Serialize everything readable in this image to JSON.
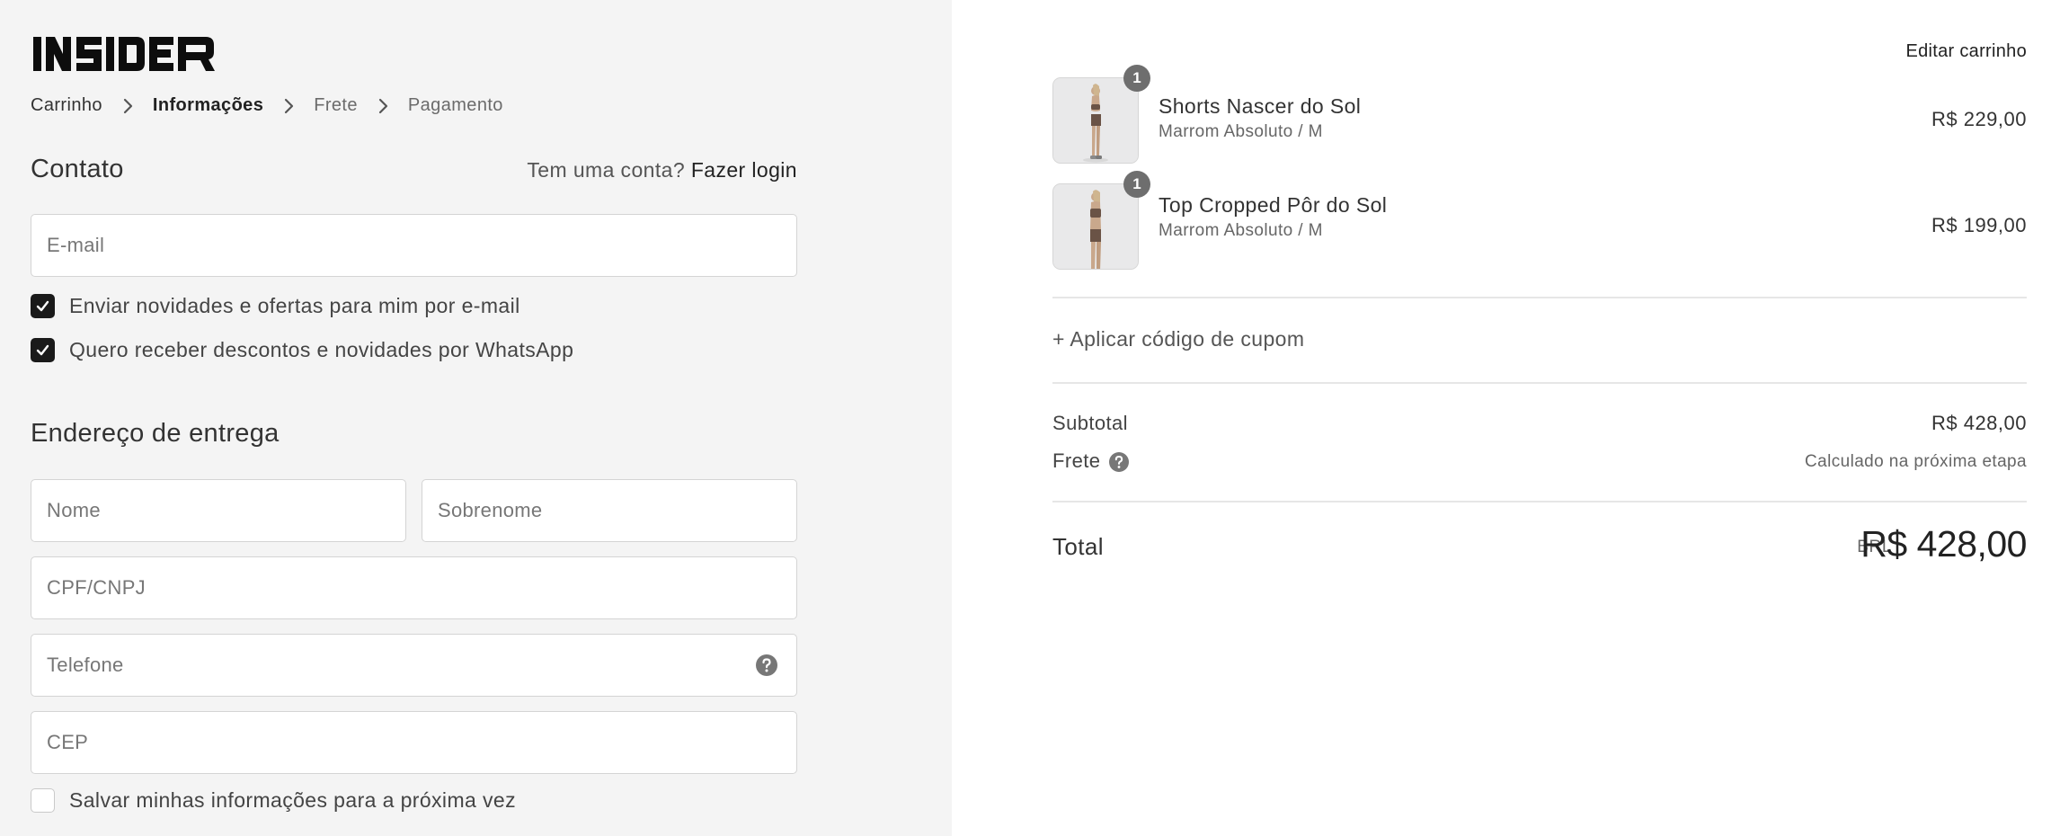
{
  "brand": {
    "logo_text": "INSIDER"
  },
  "breadcrumb": {
    "items": [
      {
        "label": "Carrinho",
        "state": "link"
      },
      {
        "label": "Informações",
        "state": "current"
      },
      {
        "label": "Frete",
        "state": "upcoming"
      },
      {
        "label": "Pagamento",
        "state": "upcoming"
      }
    ]
  },
  "contact": {
    "title": "Contato",
    "login_prompt": "Tem uma conta?",
    "login_link": "Fazer login",
    "email_placeholder": "E-mail",
    "options": [
      {
        "label": "Enviar novidades e ofertas para mim por e-mail",
        "checked": true
      },
      {
        "label": "Quero receber descontos e novidades por WhatsApp",
        "checked": true
      }
    ]
  },
  "shipping_address": {
    "title": "Endereço de entrega",
    "first_name_placeholder": "Nome",
    "last_name_placeholder": "Sobrenome",
    "document_placeholder": "CPF/CNPJ",
    "phone_placeholder": "Telefone",
    "zip_placeholder": "CEP",
    "save_info_label": "Salvar minhas informações para a próxima vez",
    "save_info_checked": false
  },
  "cart": {
    "edit_label": "Editar carrinho",
    "items": [
      {
        "name": "Shorts Nascer do Sol",
        "variant": "Marrom Absoluto / M",
        "price": "R$ 229,00",
        "quantity": "1"
      },
      {
        "name": "Top Cropped Pôr do Sol",
        "variant": "Marrom Absoluto / M",
        "price": "R$ 199,00",
        "quantity": "1"
      }
    ],
    "coupon_label": "+ Aplicar código de cupom"
  },
  "summary": {
    "subtotal_label": "Subtotal",
    "subtotal_value": "R$ 428,00",
    "shipping_label": "Frete",
    "shipping_value": "Calculado na próxima etapa",
    "total_label": "Total",
    "currency": "BRL",
    "total_value": "R$ 428,00"
  },
  "colors": {
    "left_bg": "#f4f4f4",
    "checkbox_on": "#1a1a1a",
    "qty_badge": "#6e6e6e"
  }
}
